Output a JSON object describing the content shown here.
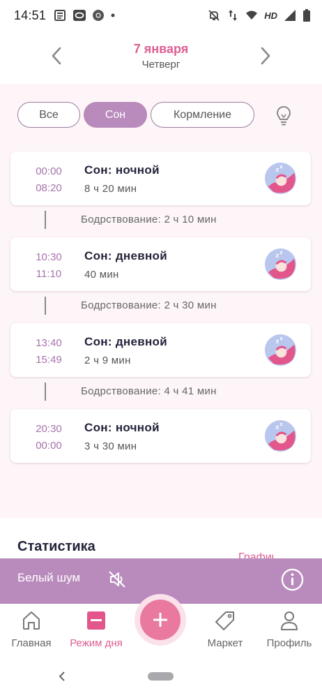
{
  "status_bar": {
    "time": "14:51",
    "network_label": "HD"
  },
  "header": {
    "date": "7 января",
    "weekday": "Четверг"
  },
  "filters": {
    "all": "Все",
    "sleep": "Сон",
    "feeding": "Кормление",
    "active": "sleep"
  },
  "entries": [
    {
      "start": "00:00",
      "end": "08:20",
      "title": "Сон: ночной",
      "duration": "8 ч 20 мин"
    },
    {
      "start": "10:30",
      "end": "11:10",
      "title": "Сон: дневной",
      "duration": "40 мин"
    },
    {
      "start": "13:40",
      "end": "15:49",
      "title": "Сон: дневной",
      "duration": "2 ч 9 мин"
    },
    {
      "start": "20:30",
      "end": "00:00",
      "title": "Сон: ночной",
      "duration": "3 ч 30 мин"
    }
  ],
  "awake_periods": [
    "Бодрствование: 2 ч 10 мин",
    "Бодрствование: 2 ч 30 мин",
    "Бодрствование: 4 ч 41 мин"
  ],
  "statistics": {
    "title": "Статистика",
    "link": "Графики"
  },
  "white_noise": {
    "label": "Белый шум"
  },
  "nav": {
    "home": "Главная",
    "routine": "Режим дня",
    "market": "Маркет",
    "profile": "Профиль"
  },
  "colors": {
    "accent_pink": "#dd5f93",
    "accent_purple": "#b98bbd",
    "time_purple": "#a774ac",
    "content_bg": "#fdf5f7",
    "fab": "#e9799f"
  },
  "icons": {
    "sleep_avatar": "sleeping-baby-icon",
    "tip": "lightbulb-icon",
    "mute": "speaker-muted-icon",
    "info": "info-icon"
  }
}
